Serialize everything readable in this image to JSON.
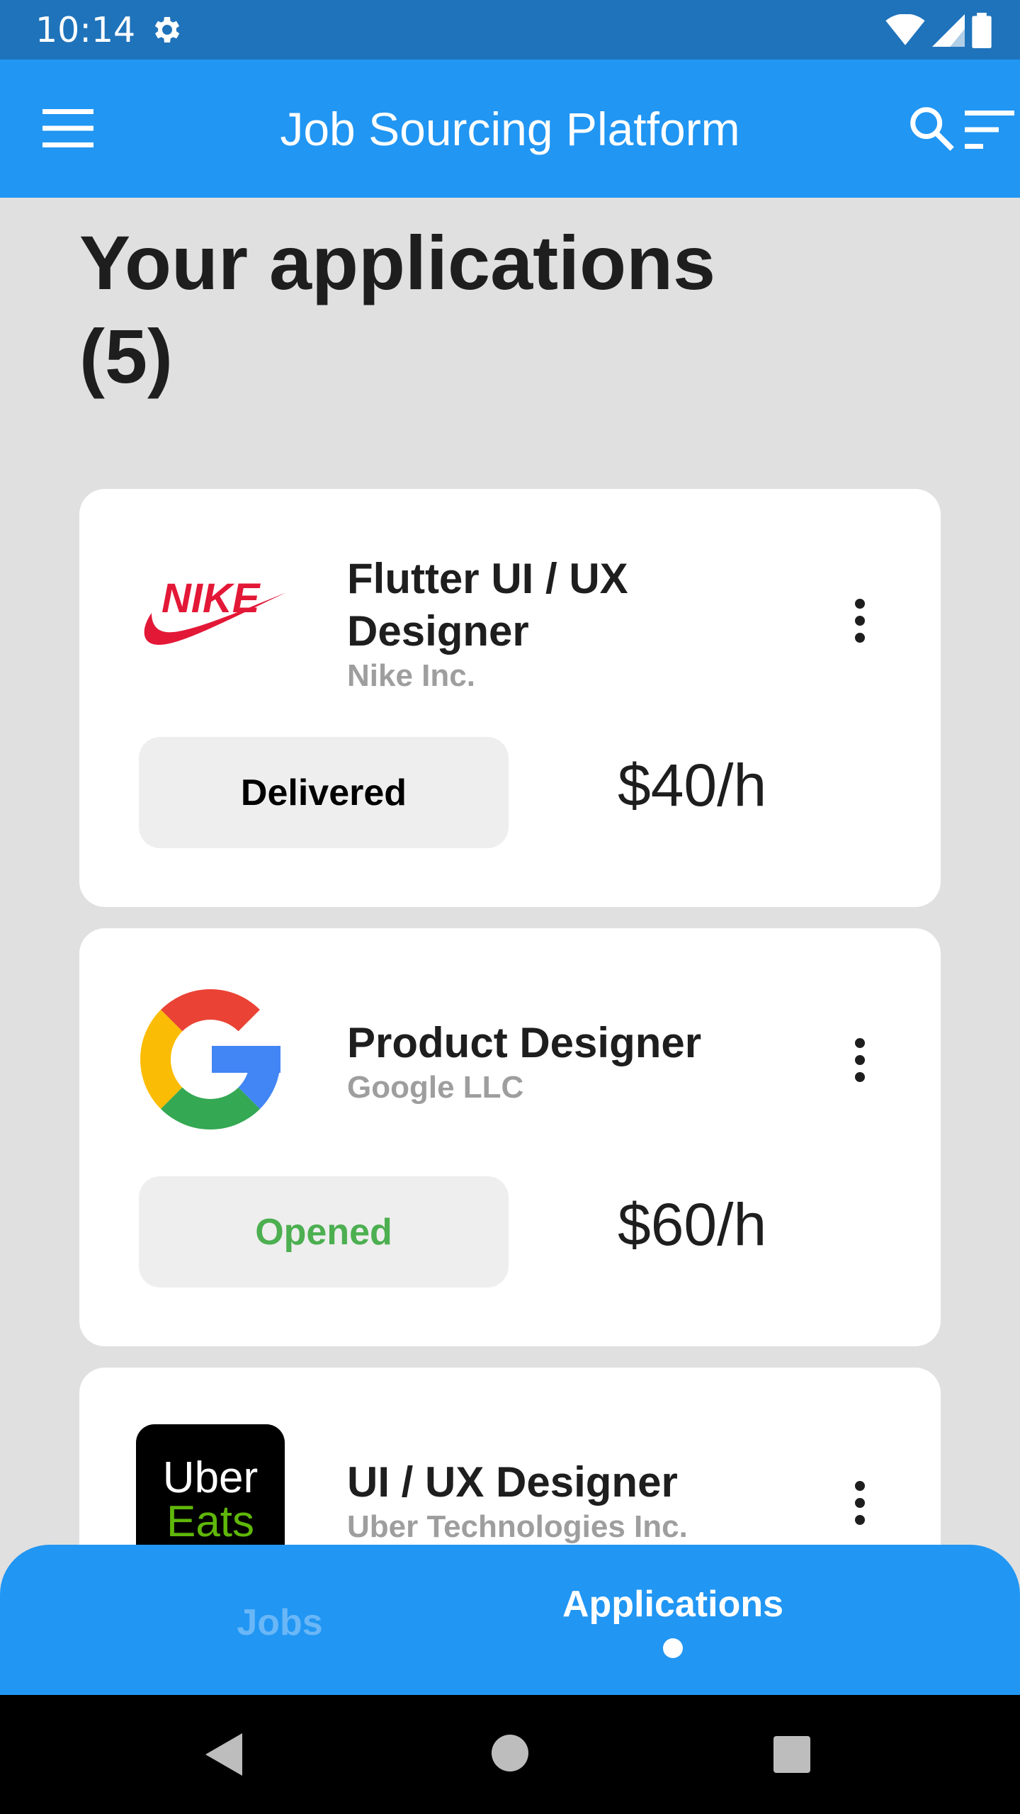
{
  "status_bar": {
    "time": "10:14"
  },
  "app_bar": {
    "title": "Job Sourcing Platform"
  },
  "page": {
    "title": "Your applications (5)"
  },
  "applications": [
    {
      "title": "Flutter UI / UX Designer",
      "company": "Nike Inc.",
      "logo": "nike-logo",
      "status": "Delivered",
      "status_color": "#000000",
      "rate": "$40/h"
    },
    {
      "title": "Product Designer",
      "company": "Google LLC",
      "logo": "google-logo",
      "status": "Opened",
      "status_color": "#4caf50",
      "rate": "$60/h"
    },
    {
      "title": "UI / UX Designer",
      "company": "Uber Technologies Inc.",
      "logo": "uber-eats-logo",
      "logo_text": [
        "Uber",
        "Eats"
      ]
    }
  ],
  "bottom_nav": {
    "items": [
      {
        "label": "Jobs",
        "active": false
      },
      {
        "label": "Applications",
        "active": true
      }
    ]
  },
  "colors": {
    "primary": "#2196f3",
    "status_bar": "#1f73bb",
    "background": "#e0e0e0",
    "inactive_tab": "#6ab7f7"
  }
}
